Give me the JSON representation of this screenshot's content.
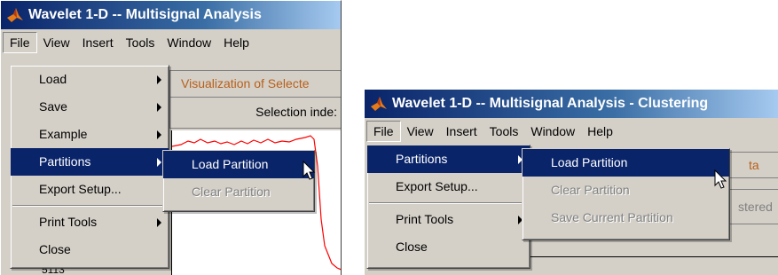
{
  "window1": {
    "title": "Wavelet 1-D -- Multisignal Analysis",
    "menubar": [
      "File",
      "View",
      "Insert",
      "Tools",
      "Window",
      "Help"
    ],
    "file_menu": {
      "load": "Load",
      "save": "Save",
      "example": "Example",
      "partitions": "Partitions",
      "export_setup": "Export Setup...",
      "print_tools": "Print Tools",
      "close": "Close"
    },
    "partitions_submenu": {
      "load_partition": "Load Partition",
      "clear_partition": "Clear Partition"
    },
    "panel_title": "Visualization of Selecte",
    "selection_index": "Selection inde:",
    "axis_fragment": "5113"
  },
  "window2": {
    "title": "Wavelet 1-D -- Multisignal Analysis - Clustering",
    "menubar": [
      "File",
      "View",
      "Insert",
      "Tools",
      "Window",
      "Help"
    ],
    "file_menu": {
      "partitions": "Partitions",
      "export_setup": "Export Setup...",
      "print_tools": "Print Tools",
      "close": "Close"
    },
    "partitions_submenu": {
      "load_partition": "Load Partition",
      "clear_partition": "Clear Partition",
      "save_current_partition": "Save Current Partition"
    },
    "bg_fragment_1": "ta",
    "bg_fragment_2": "stered"
  },
  "colors": {
    "title_bar": "#0a246a",
    "menu_highlight": "#0a246a",
    "panel_text": "#b8601a",
    "signal": "#ff0000"
  },
  "icons": [
    "matlab-logo-icon",
    "submenu-arrow-icon",
    "mouse-pointer-icon"
  ]
}
